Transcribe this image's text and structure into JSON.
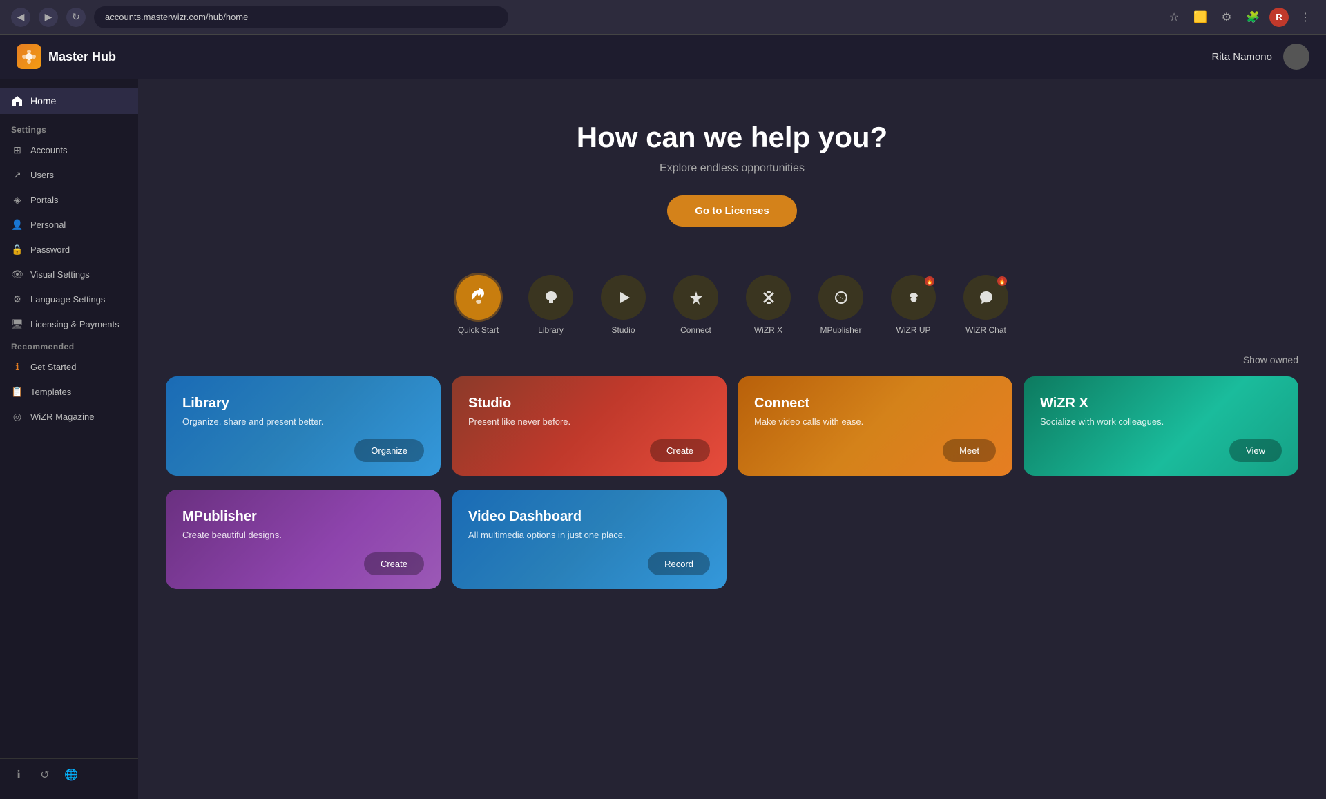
{
  "browser": {
    "url": "accounts.masterwizr.com/hub/home",
    "nav_back": "◀",
    "nav_forward": "▶",
    "reload": "↻",
    "user_initial": "R"
  },
  "topnav": {
    "logo_icon": "🔷",
    "app_name": "Master Hub",
    "user_name": "Rita Namono"
  },
  "sidebar": {
    "home_label": "Home",
    "settings_section": "Settings",
    "recommended_section": "Recommended",
    "items_settings": [
      {
        "label": "Accounts",
        "icon": "⊞"
      },
      {
        "label": "Users",
        "icon": "↗"
      },
      {
        "label": "Portals",
        "icon": "◈"
      },
      {
        "label": "Personal",
        "icon": "👤"
      },
      {
        "label": "Password",
        "icon": "🔒"
      },
      {
        "label": "Visual Settings",
        "icon": "👁"
      },
      {
        "label": "Language Settings",
        "icon": "⚙"
      },
      {
        "label": "Licensing & Payments",
        "icon": "🖥"
      }
    ],
    "items_recommended": [
      {
        "label": "Get Started",
        "icon": "ℹ"
      },
      {
        "label": "Templates",
        "icon": "📋"
      },
      {
        "label": "WiZR Magazine",
        "icon": "◎"
      }
    ],
    "footer_icons": [
      "ℹ",
      "↺",
      "🌐"
    ]
  },
  "hero": {
    "title": "How can we help you?",
    "subtitle": "Explore endless opportunities",
    "button_label": "Go to Licenses"
  },
  "app_icons": [
    {
      "label": "Quick Start",
      "icon": "🚀",
      "active": true
    },
    {
      "label": "Library",
      "icon": "☁",
      "active": false
    },
    {
      "label": "Studio",
      "icon": "▶",
      "active": false
    },
    {
      "label": "Connect",
      "icon": "⚡",
      "active": false
    },
    {
      "label": "WiZR X",
      "icon": "✖",
      "active": false
    },
    {
      "label": "MPublisher",
      "icon": "↻",
      "active": false
    },
    {
      "label": "WiZR UP",
      "icon": "✿",
      "active": false,
      "badge": true
    },
    {
      "label": "WiZR Chat",
      "icon": "💬",
      "active": false,
      "badge": true
    }
  ],
  "show_owned_label": "Show owned",
  "cards_row1": [
    {
      "key": "library",
      "title": "Library",
      "subtitle": "Organize, share and present better.",
      "button": "Organize",
      "class": "library"
    },
    {
      "key": "studio",
      "title": "Studio",
      "subtitle": "Present like never before.",
      "button": "Create",
      "class": "studio"
    },
    {
      "key": "connect",
      "title": "Connect",
      "subtitle": "Make video calls with ease.",
      "button": "Meet",
      "class": "connect"
    },
    {
      "key": "wizr-x",
      "title": "WiZR X",
      "subtitle": "Socialize with work colleagues.",
      "button": "View",
      "class": "wizr-x"
    }
  ],
  "cards_row2": [
    {
      "key": "mpublisher",
      "title": "MPublisher",
      "subtitle": "Create beautiful designs.",
      "button": "Create",
      "class": "mpublisher"
    },
    {
      "key": "video-dashboard",
      "title": "Video Dashboard",
      "subtitle": "All multimedia options in just one place.",
      "button": "Record",
      "class": "video-dashboard"
    }
  ]
}
